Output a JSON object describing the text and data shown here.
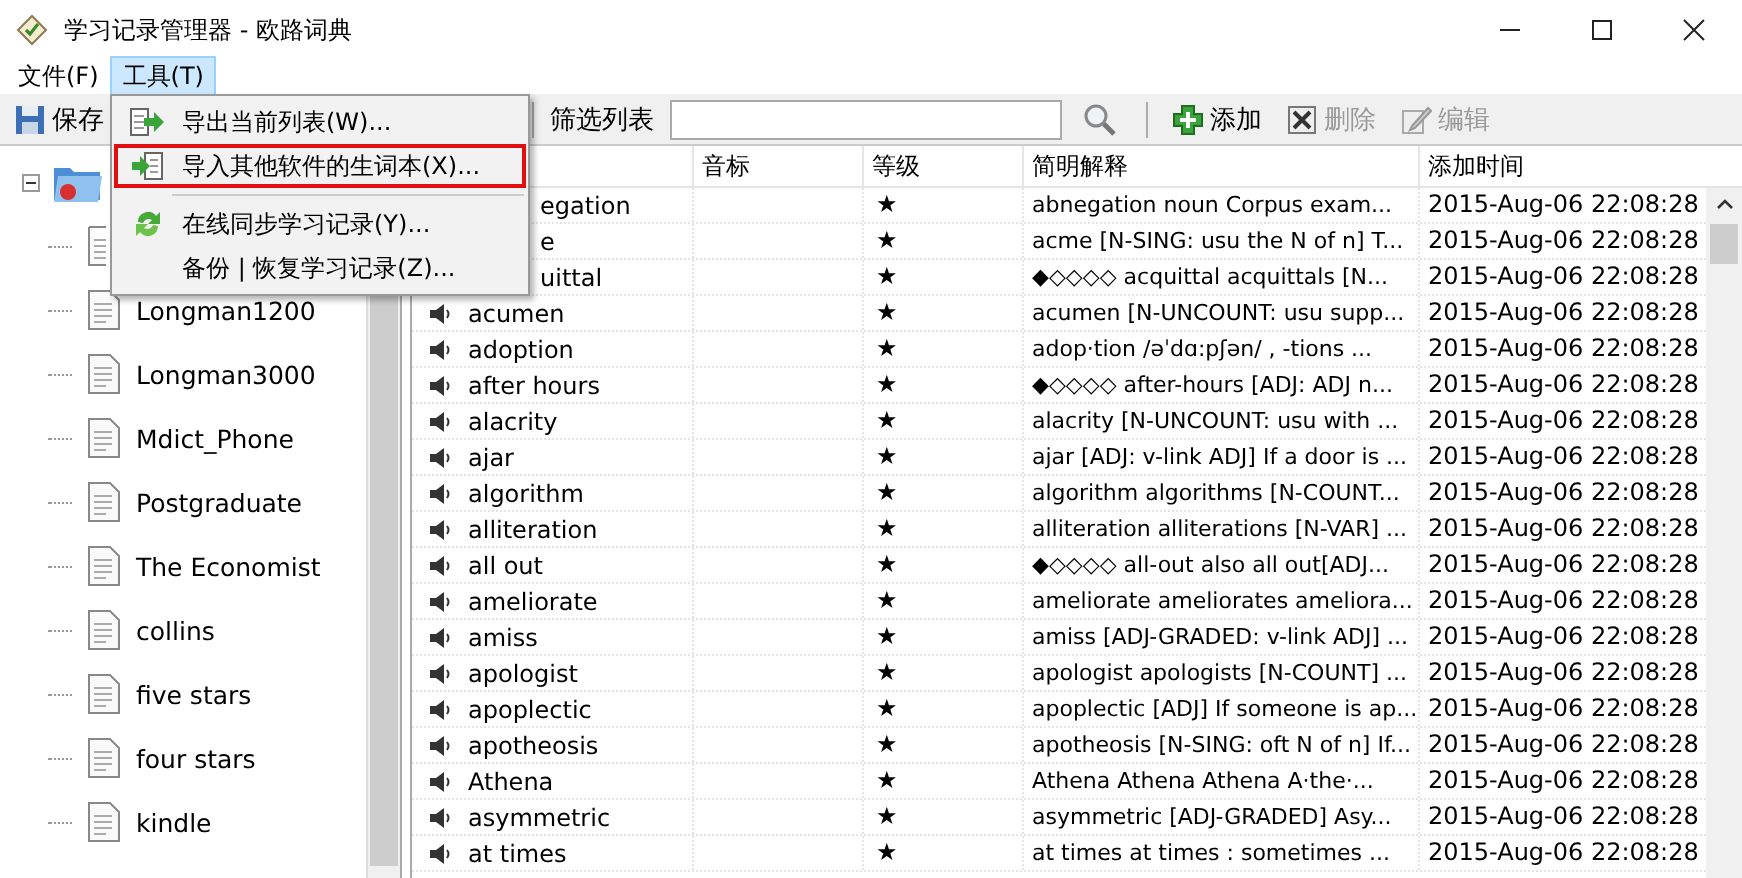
{
  "window": {
    "title": "学习记录管理器 - 欧路词典"
  },
  "menu_bar": [
    {
      "label": "文件(F)",
      "selected": false
    },
    {
      "label": "工具(T)",
      "selected": true
    }
  ],
  "toolbar": {
    "save": "保存",
    "filter_label": "筛选列表",
    "buttons": [
      {
        "kind": "add",
        "label": "添加",
        "disabled": false
      },
      {
        "kind": "delete",
        "label": "删除",
        "disabled": true
      },
      {
        "kind": "edit",
        "label": "编辑",
        "disabled": true
      }
    ]
  },
  "tools_menu": [
    {
      "kind": "export",
      "label": "导出当前列表(W)...",
      "highlighted": false
    },
    {
      "kind": "import",
      "label": "导入其他软件的生词本(X)...",
      "highlighted": true
    },
    {
      "kind": "separator"
    },
    {
      "kind": "sync",
      "label": "在线同步学习记录(Y)...",
      "highlighted": false
    },
    {
      "kind": "plain",
      "label": "备份 | 恢复学习记录(Z)...",
      "highlighted": false
    }
  ],
  "tree": {
    "root": {
      "expanded": true
    },
    "items": [
      {
        "covered": true
      },
      {
        "label": "Longman1200"
      },
      {
        "label": "Longman3000"
      },
      {
        "label": "Mdict_Phone"
      },
      {
        "label": "Postgraduate"
      },
      {
        "label": "The Economist"
      },
      {
        "label": "collins"
      },
      {
        "label": "five stars"
      },
      {
        "label": "four stars"
      },
      {
        "label": "kindle"
      }
    ]
  },
  "table": {
    "columns": [
      "音标",
      "等级",
      "简明解释",
      "添加时间"
    ],
    "rows": [
      {
        "word": "egation",
        "covered": true,
        "level": "★",
        "definition": "abnegation  noun   Corpus exam...",
        "time": "2015-Aug-06 22:08:28"
      },
      {
        "word": "e",
        "covered": true,
        "level": "★",
        "definition": "acme [N-SING: usu the N of n]  T...",
        "time": "2015-Aug-06 22:08:28"
      },
      {
        "word": "uittal",
        "covered": true,
        "level": "★",
        "definition": "◆◇◇◇◇  acquittal  acquittals [N...",
        "time": "2015-Aug-06 22:08:28"
      },
      {
        "word": "acumen",
        "covered": false,
        "level": "★",
        "definition": "acumen [N-UNCOUNT: usu supp...",
        "time": "2015-Aug-06 22:08:28"
      },
      {
        "word": "adoption",
        "covered": false,
        "level": "★",
        "definition": "adop·tion   /əˈdɑ:pʃən/  ,   -tions  ...",
        "time": "2015-Aug-06 22:08:28"
      },
      {
        "word": "after hours",
        "covered": false,
        "level": "★",
        "definition": "◆◇◇◇◇  after-hours [ADJ: ADJ n...",
        "time": "2015-Aug-06 22:08:28"
      },
      {
        "word": "alacrity",
        "covered": false,
        "level": "★",
        "definition": "alacrity [N-UNCOUNT: usu with ...",
        "time": "2015-Aug-06 22:08:28"
      },
      {
        "word": "ajar",
        "covered": false,
        "level": "★",
        "definition": "ajar [ADJ: v-link ADJ]  If a door is ...",
        "time": "2015-Aug-06 22:08:28"
      },
      {
        "word": "algorithm",
        "covered": false,
        "level": "★",
        "definition": "algorithm  algorithms [N-COUNT...",
        "time": "2015-Aug-06 22:08:28"
      },
      {
        "word": "alliteration",
        "covered": false,
        "level": "★",
        "definition": "alliteration  alliterations [N-VAR]  ...",
        "time": "2015-Aug-06 22:08:28"
      },
      {
        "word": "all out",
        "covered": false,
        "level": "★",
        "definition": "◆◇◇◇◇  all-out  also all out[ADJ...",
        "time": "2015-Aug-06 22:08:28"
      },
      {
        "word": "ameliorate",
        "covered": false,
        "level": "★",
        "definition": "ameliorate  ameliorates  ameliora...",
        "time": "2015-Aug-06 22:08:28"
      },
      {
        "word": "amiss",
        "covered": false,
        "level": "★",
        "definition": "amiss [ADJ-GRADED: v-link ADJ]  ...",
        "time": "2015-Aug-06 22:08:28"
      },
      {
        "word": "apologist",
        "covered": false,
        "level": "★",
        "definition": "apologist  apologists [N-COUNT] ...",
        "time": "2015-Aug-06 22:08:28"
      },
      {
        "word": "apoplectic",
        "covered": false,
        "level": "★",
        "definition": "apoplectic [ADJ]  If someone is ap...",
        "time": "2015-Aug-06 22:08:28"
      },
      {
        "word": "apotheosis",
        "covered": false,
        "level": "★",
        "definition": "apotheosis [N-SING: oft N of n]  If...",
        "time": "2015-Aug-06 22:08:28"
      },
      {
        "word": "Athena",
        "covered": false,
        "level": "★",
        "definition": "Athena    Athena  Athena  A·the·...",
        "time": "2015-Aug-06 22:08:28"
      },
      {
        "word": "asymmetric",
        "covered": false,
        "level": "★",
        "definition": "asymmetric [ADJ-GRADED]  Asy...",
        "time": "2015-Aug-06 22:08:28"
      },
      {
        "word": "at times",
        "covered": false,
        "level": "★",
        "definition": "at times   at times   : sometimes   ...",
        "time": "2015-Aug-06 22:08:28"
      }
    ]
  }
}
